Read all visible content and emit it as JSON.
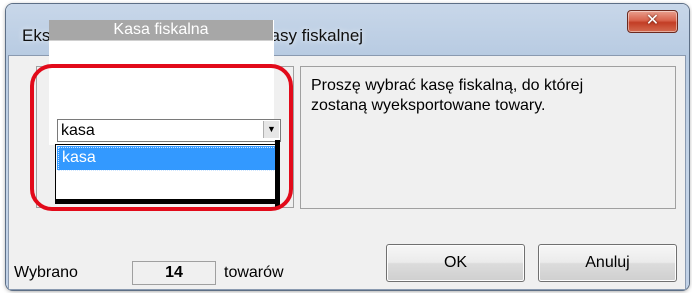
{
  "window": {
    "title": "Eksport wybranych towarów do kasy fiskalnej",
    "close_icon": "close-x-icon"
  },
  "group": {
    "header": "Kasa fiskalna",
    "combo_value": "kasa",
    "combo_arrow_icon": "chevron-down-icon",
    "dropdown_items": [
      "kasa"
    ]
  },
  "info": {
    "line1": "Proszę wybrać kasę fiskalną, do której",
    "line2": "zostaną wyeksportowane towary."
  },
  "summary": {
    "prefix": "Wybrano",
    "count": "14",
    "suffix": "towarów"
  },
  "buttons": {
    "ok_label": "OK",
    "cancel_label": "Anuluj"
  },
  "colors": {
    "highlight": "#e20a1a",
    "selection": "#3399ff"
  }
}
